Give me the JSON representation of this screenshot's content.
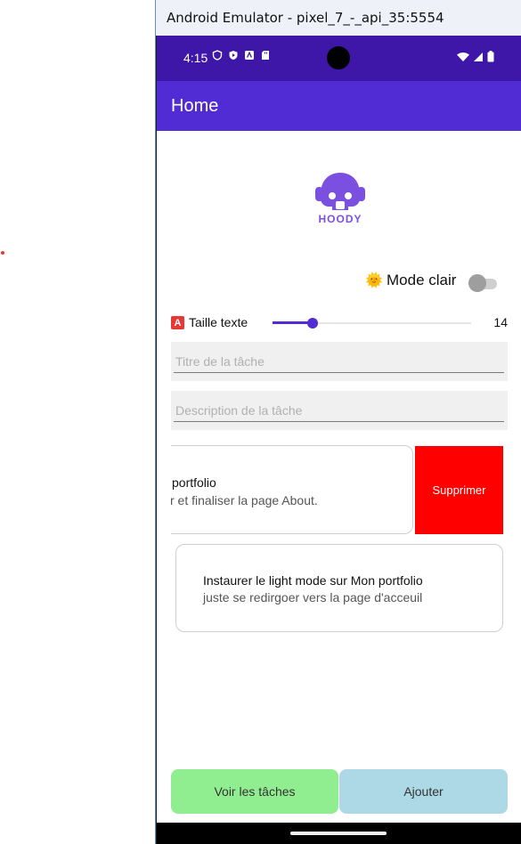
{
  "window": {
    "title": "Android Emulator - pixel_7_-_api_35:5554"
  },
  "status_bar": {
    "time": "4:15"
  },
  "app_bar": {
    "title": "Home"
  },
  "logo": {
    "text": "HOODY",
    "color": "#7b4fe0"
  },
  "mode": {
    "emoji": "🌞",
    "label": "Mode clair",
    "on": false
  },
  "text_size": {
    "badge": "A",
    "label": "Taille texte",
    "value": "14",
    "fraction": 0.2
  },
  "inputs": {
    "title_placeholder": "Titre de la tâche",
    "description_placeholder": "Description de la tâche"
  },
  "tasks": [
    {
      "title": "portfolio",
      "description": "r et finaliser la page About."
    },
    {
      "title": "Instaurer le light mode sur Mon portfolio",
      "description": "juste se redirgoer vers la page d'acceuil"
    }
  ],
  "swipe_action": {
    "label": "Supprimer",
    "color": "#ff0000"
  },
  "buttons": {
    "view": {
      "label": "Voir les tâches",
      "color": "#90ee90"
    },
    "add": {
      "label": "Ajouter",
      "color": "#add8e6"
    }
  },
  "colors": {
    "primary": "#512bd4",
    "status_bar": "#3f17a8"
  }
}
